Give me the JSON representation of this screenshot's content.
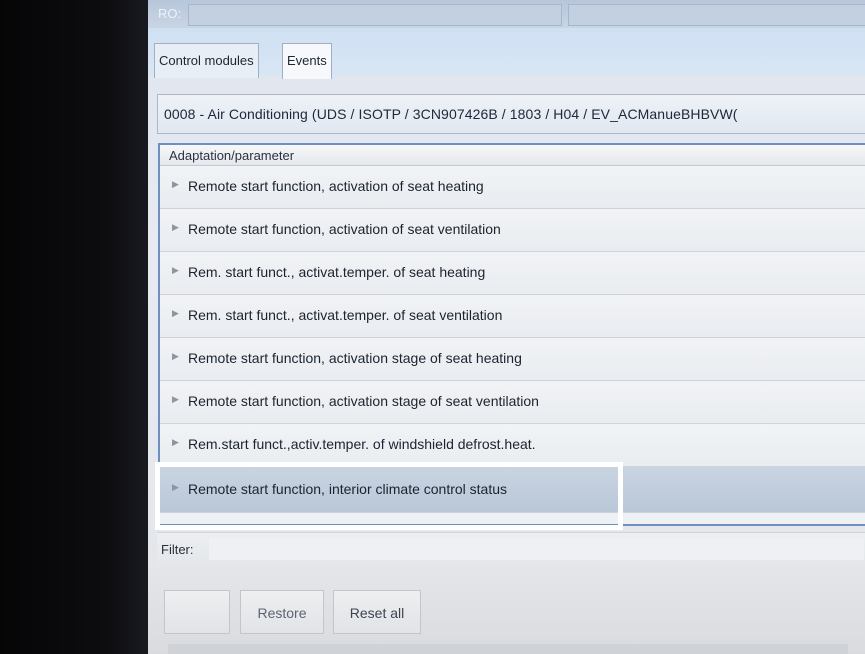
{
  "header": {
    "field_label": "RO:"
  },
  "tabs": [
    {
      "label": "Control modules"
    },
    {
      "label": "Events"
    }
  ],
  "module": {
    "text": "0008 - Air Conditioning  (UDS / ISOTP / 3CN907426B / 1803 / H04 / EV_ACManueBHBVW("
  },
  "panel": {
    "header": "Adaptation/parameter",
    "rows": [
      {
        "label": "Remote start function, activation of seat heating"
      },
      {
        "label": "Remote start function, activation of seat ventilation"
      },
      {
        "label": "Rem. start funct., activat.temper. of seat heating"
      },
      {
        "label": "Rem. start funct., activat.temper. of seat ventilation"
      },
      {
        "label": "Remote start function, activation stage of seat heating"
      },
      {
        "label": "Remote start function, activation stage of seat ventilation"
      },
      {
        "label": "Rem.start funct.,activ.temper. of windshield defrost.heat."
      },
      {
        "label": "Remote start function, interior climate control status"
      }
    ],
    "selected_index": 7,
    "expand_icon": "triangle-right-icon"
  },
  "filter": {
    "label": "Filter:",
    "value": ""
  },
  "buttons": {
    "blank": "",
    "restore": "Restore",
    "reset_all": "Reset all"
  },
  "colors": {
    "panel_border": "#6e8fbf",
    "highlight_box": "#ffffff",
    "selected_row": "#b9c7d8"
  }
}
